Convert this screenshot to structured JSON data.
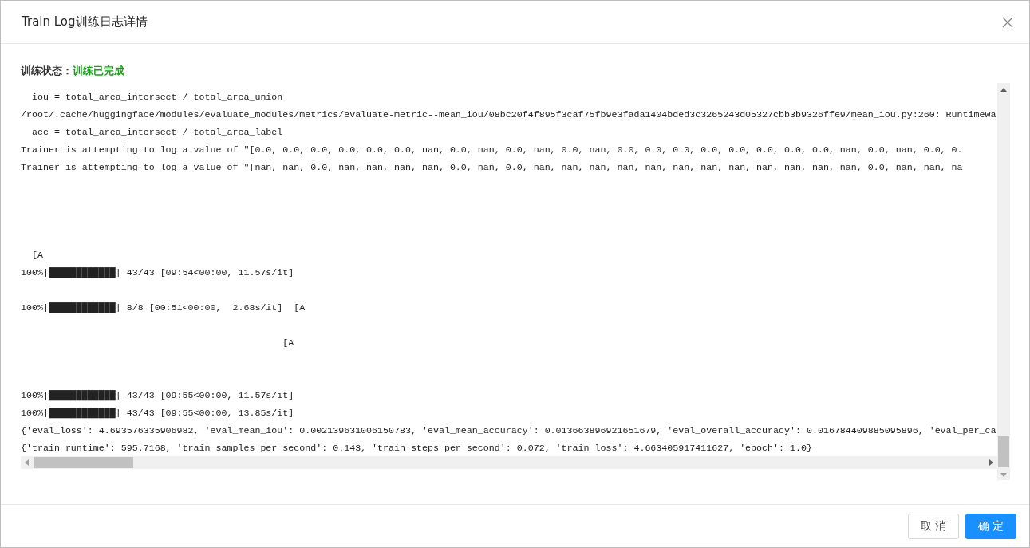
{
  "dialog": {
    "title": "Train Log训练日志详情"
  },
  "status": {
    "label": "训练状态：",
    "value": "训练已完成",
    "kind": "success"
  },
  "log": {
    "lines": [
      {
        "text": "  iou = total_area_intersect / total_area_union"
      },
      {
        "text": "/root/.cache/huggingface/modules/evaluate_modules/metrics/evaluate-metric--mean_iou/08bc20f4f895f3caf75fb9e3fada1404bded3c3265243d05327cbb3b9326ffe9/mean_iou.py:260: RuntimeWa"
      },
      {
        "text": "  acc = total_area_intersect / total_area_label"
      },
      {
        "text": "Trainer is attempting to log a value of \"[0.0, 0.0, 0.0, 0.0, 0.0, 0.0, nan, 0.0, nan, 0.0, nan, 0.0, nan, 0.0, 0.0, 0.0, 0.0, 0.0, 0.0, 0.0, 0.0, nan, 0.0, nan, 0.0, 0."
      },
      {
        "text": "Trainer is attempting to log a value of \"[nan, nan, 0.0, nan, nan, nan, nan, 0.0, nan, 0.0, nan, nan, nan, nan, nan, nan, nan, nan, nan, nan, nan, nan, 0.0, nan, nan, na"
      },
      {
        "text": "  [A"
      },
      {
        "text": "100%|████████████| 43/43 [09:54<00:00, 11.57s/it]"
      },
      {
        "text": "100%|████████████| 8/8 [00:51<00:00,  2.68s/it]  [A"
      },
      {
        "text": "                                               [A"
      },
      {
        "text": "100%|████████████| 43/43 [09:55<00:00, 11.57s/it]"
      },
      {
        "text": "100%|████████████| 43/43 [09:55<00:00, 13.85s/it]"
      },
      {
        "text": "{'eval_loss': 4.693576335906982, 'eval_mean_iou': 0.002139631006150783, 'eval_mean_accuracy': 0.013663896921651679, 'eval_overall_accuracy': 0.016784409885095896, 'eval_per_ca"
      },
      {
        "text": "{'train_runtime': 595.7168, 'train_samples_per_second': 0.143, 'train_steps_per_second': 0.072, 'train_loss': 4.663405917411627, 'epoch': 1.0}"
      }
    ]
  },
  "buttons": [
    {
      "label": "取 消",
      "kind": "default"
    },
    {
      "label": "确 定",
      "kind": "primary"
    }
  ]
}
